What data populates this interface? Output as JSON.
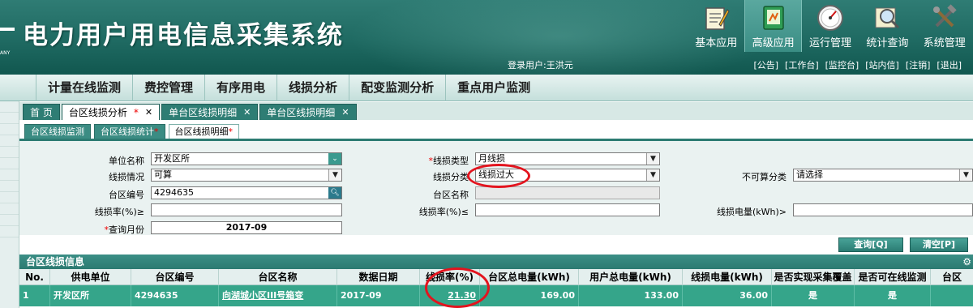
{
  "header": {
    "title": "电力用户用电信息采集系统",
    "logo_text": "ANY",
    "login_user": "登录用户:王洪元",
    "tools": [
      {
        "label": "基本应用",
        "icon": "notepad-icon",
        "active": false
      },
      {
        "label": "高级应用",
        "icon": "tablet-icon",
        "active": true
      },
      {
        "label": "运行管理",
        "icon": "gauge-icon",
        "active": false
      },
      {
        "label": "统计查询",
        "icon": "magnifier-icon",
        "active": false
      },
      {
        "label": "系统管理",
        "icon": "tools-icon",
        "active": false
      }
    ],
    "quick_links": [
      "[公告]",
      "[工作台]",
      "[监控台]",
      "[站内信]",
      "[注销]",
      "[退出]"
    ]
  },
  "main_nav": [
    "计量在线监测",
    "费控管理",
    "有序用电",
    "线损分析",
    "配变监测分析",
    "重点用户监测"
  ],
  "tabs_level1": [
    {
      "label": "首 页",
      "closable": false,
      "active": false,
      "required": false
    },
    {
      "label": "台区线损分析",
      "closable": true,
      "active": true,
      "required": true
    },
    {
      "label": "单台区线损明细",
      "closable": true,
      "active": false,
      "required": false
    },
    {
      "label": "单台区线损明细",
      "closable": true,
      "active": false,
      "required": false
    }
  ],
  "tabs_level2": [
    {
      "label": "台区线损监测",
      "active": false,
      "required": false
    },
    {
      "label": "台区线损统计",
      "active": false,
      "required": true
    },
    {
      "label": "台区线损明细",
      "active": true,
      "required": true
    }
  ],
  "form": {
    "unit_label": "单位名称",
    "unit_value": "开发区所",
    "loss_type_label": "线损类型",
    "loss_type_value": "月线损",
    "loss_status_label": "线损情况",
    "loss_status_value": "可算",
    "loss_category_label": "线损分类",
    "loss_category_value": "线损过大",
    "noncalc_label": "不可算分类",
    "noncalc_value": "请选择",
    "area_code_label": "台区编号",
    "area_code_value": "4294635",
    "area_name_label": "台区名称",
    "area_name_value": "",
    "rate_ge_label": "线损率(%)≥",
    "rate_ge_value": "",
    "rate_le_label": "线损率(%)≤",
    "rate_le_value": "",
    "loss_energy_label": "线损电量(kWh)>",
    "loss_energy_value": "",
    "month_label": "查询月份",
    "month_value": "2017-09",
    "query_button": "查询[Q]",
    "clear_button": "清空[P]"
  },
  "result": {
    "panel_title": "台区线损信息",
    "columns": [
      "No.",
      "供电单位",
      "台区编号",
      "台区名称",
      "数据日期",
      "线损率(%)",
      "台区总电量(kWh)",
      "用户总电量(kWh)",
      "线损电量(kWh)",
      "是否实现采集覆盖",
      "是否可在线监测",
      "台区"
    ],
    "rows": [
      {
        "no": "1",
        "unit": "开发区所",
        "code": "4294635",
        "name": "向湖城小区III号箱变",
        "date": "2017-09",
        "rate": "21.30",
        "total": "169.00",
        "user_total": "133.00",
        "loss": "36.00",
        "covered": "是",
        "online": "是",
        "extra": ""
      }
    ]
  }
}
